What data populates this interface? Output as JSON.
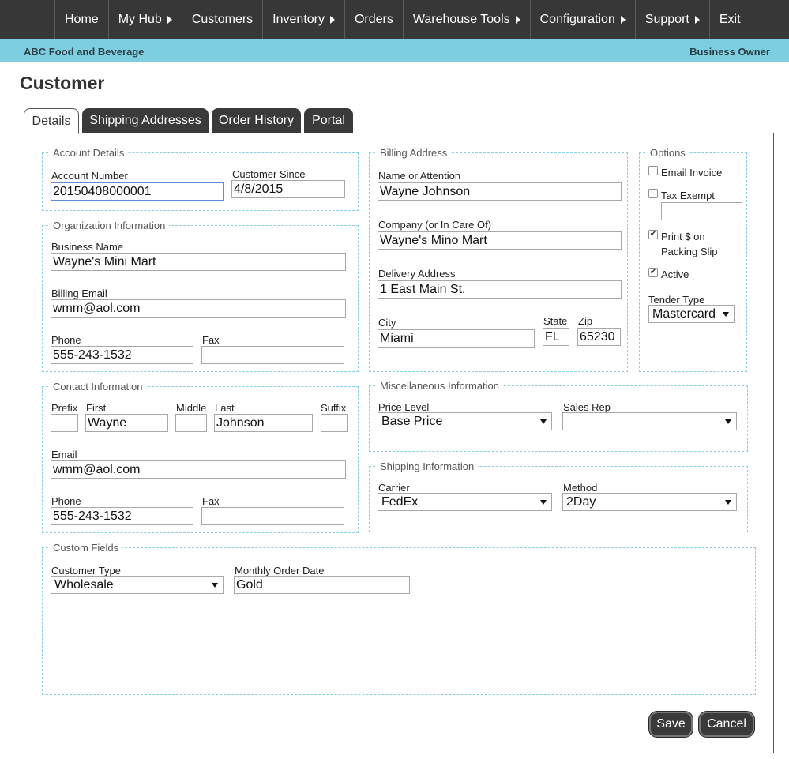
{
  "nav": {
    "items": [
      {
        "label": "Home",
        "has_arrow": false
      },
      {
        "label": "My Hub",
        "has_arrow": true
      },
      {
        "label": "Customers",
        "has_arrow": false
      },
      {
        "label": "Inventory",
        "has_arrow": true
      },
      {
        "label": "Orders",
        "has_arrow": false
      },
      {
        "label": "Warehouse Tools",
        "has_arrow": true
      },
      {
        "label": "Configuration",
        "has_arrow": true
      },
      {
        "label": "Support",
        "has_arrow": true
      },
      {
        "label": "Exit",
        "has_arrow": false
      }
    ]
  },
  "subbar": {
    "company": "ABC Food and Beverage",
    "role": "Business Owner"
  },
  "page": {
    "title": "Customer"
  },
  "tabs": {
    "details": "Details",
    "shipping": "Shipping Addresses",
    "orders": "Order History",
    "portal": "Portal"
  },
  "account": {
    "legend": "Account Details",
    "number_label": "Account Number",
    "number_value": "20150408000001",
    "since_label": "Customer Since",
    "since_value": "4/8/2015"
  },
  "org": {
    "legend": "Organization Information",
    "business_label": "Business Name",
    "business_value": "Wayne's Mini Mart",
    "email_label": "Billing Email",
    "email_value": "wmm@aol.com",
    "phone_label": "Phone",
    "phone_value": "555-243-1532",
    "fax_label": "Fax",
    "fax_value": ""
  },
  "contact": {
    "legend": "Contact Information",
    "prefix_label": "Prefix",
    "prefix_value": "",
    "first_label": "First",
    "first_value": "Wayne",
    "middle_label": "Middle",
    "middle_value": "",
    "last_label": "Last",
    "last_value": "Johnson",
    "suffix_label": "Suffix",
    "suffix_value": "",
    "email_label": "Email",
    "email_value": "wmm@aol.com",
    "phone_label": "Phone",
    "phone_value": "555-243-1532",
    "fax_label": "Fax",
    "fax_value": ""
  },
  "billing": {
    "legend": "Billing Address",
    "name_label": "Name or Attention",
    "name_value": "Wayne Johnson",
    "company_label": "Company (or In Care Of)",
    "company_value": "Wayne's Mino Mart",
    "address_label": "Delivery Address",
    "address_value": "1 East Main St.",
    "city_label": "City",
    "city_value": "Miami",
    "state_label": "State",
    "state_value": "FL",
    "zip_label": "Zip",
    "zip_value": "65230"
  },
  "options": {
    "legend": "Options",
    "email_invoice_label": "Email Invoice",
    "email_invoice_checked": false,
    "tax_exempt_label": "Tax Exempt",
    "tax_exempt_checked": false,
    "tax_exempt_value": "",
    "print_label_1": "Print $ on",
    "print_label_2": "Packing Slip",
    "print_checked": true,
    "active_label": "Active",
    "active_checked": true,
    "tender_label": "Tender Type",
    "tender_value": "Mastercard"
  },
  "misc": {
    "legend": "Miscellaneous Information",
    "price_label": "Price Level",
    "price_value": "Base Price",
    "rep_label": "Sales Rep",
    "rep_value": ""
  },
  "shipping": {
    "legend": "Shipping Information",
    "carrier_label": "Carrier",
    "carrier_value": "FedEx",
    "method_label": "Method",
    "method_value": "2Day"
  },
  "custom": {
    "legend": "Custom Fields",
    "type_label": "Customer Type",
    "type_value": "Wholesale",
    "monthly_label": "Monthly Order Date",
    "monthly_value": "Gold"
  },
  "buttons": {
    "save": "Save",
    "cancel": "Cancel"
  },
  "colors": {
    "nav_bg": "#373737",
    "subbar_bg": "#7dcfe0",
    "fieldset_border": "#8ccfe0",
    "button_bg": "#3a3a3a"
  }
}
